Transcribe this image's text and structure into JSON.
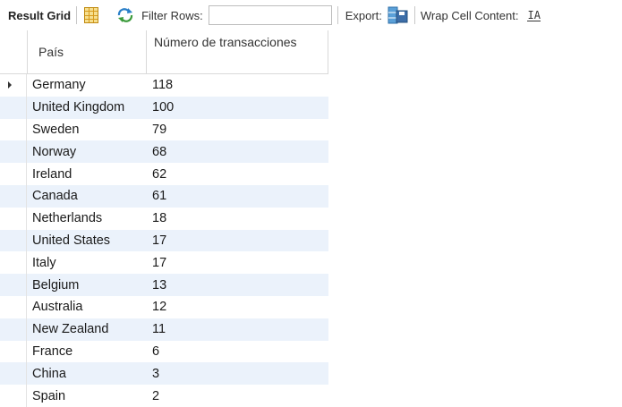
{
  "toolbar": {
    "title": "Result Grid",
    "filter_label": "Filter Rows:",
    "filter_value": "",
    "export_label": "Export:",
    "wrap_label": "Wrap Cell Content:",
    "wrap_icon_text": "IA"
  },
  "grid": {
    "columns": [
      "País",
      "Número de transacciones"
    ],
    "rows": [
      {
        "pais": "Germany",
        "num": "118"
      },
      {
        "pais": "United Kingdom",
        "num": "100"
      },
      {
        "pais": "Sweden",
        "num": "79"
      },
      {
        "pais": "Norway",
        "num": "68"
      },
      {
        "pais": "Ireland",
        "num": "62"
      },
      {
        "pais": "Canada",
        "num": "61"
      },
      {
        "pais": "Netherlands",
        "num": "18"
      },
      {
        "pais": "United States",
        "num": "17"
      },
      {
        "pais": "Italy",
        "num": "17"
      },
      {
        "pais": "Belgium",
        "num": "13"
      },
      {
        "pais": "Australia",
        "num": "12"
      },
      {
        "pais": "New Zealand",
        "num": "11"
      },
      {
        "pais": "France",
        "num": "6"
      },
      {
        "pais": "China",
        "num": "3"
      },
      {
        "pais": "Spain",
        "num": "2"
      }
    ]
  }
}
